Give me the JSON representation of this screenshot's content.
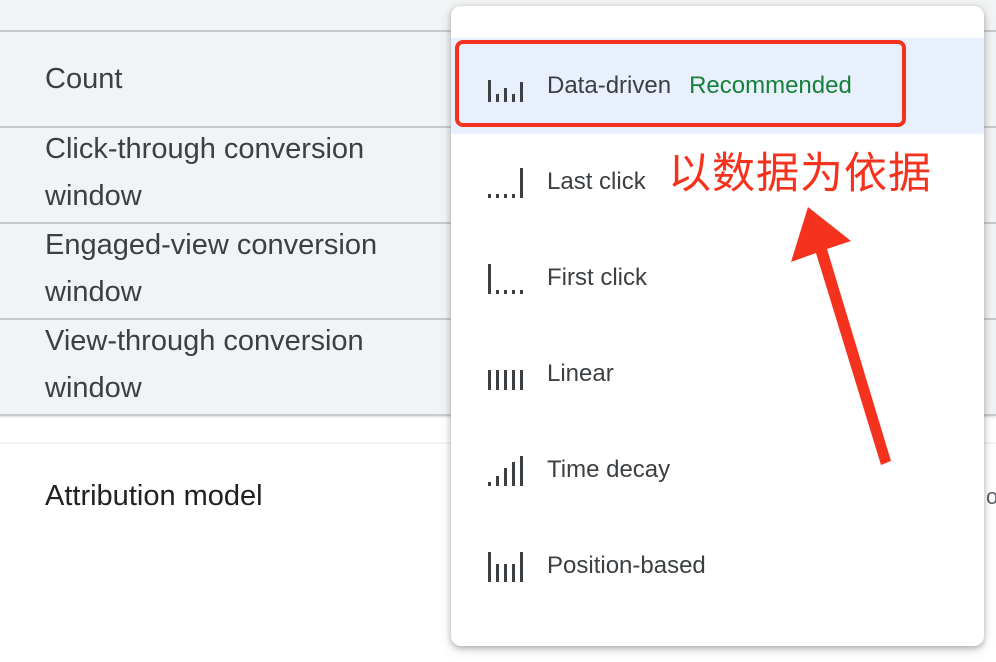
{
  "settings": {
    "rows": [
      {
        "label": "Count"
      },
      {
        "label": "Click-through conversion window"
      },
      {
        "label": "Engaged-view conversion window"
      },
      {
        "label": "View-through conversion window"
      }
    ],
    "attribution": {
      "label": "Attribution model",
      "edge_text": "o"
    }
  },
  "menu": {
    "items": [
      {
        "icon": "data-driven-icon",
        "label": "Data-driven",
        "badge": "Recommended",
        "selected": true
      },
      {
        "icon": "last-click-icon",
        "label": "Last click"
      },
      {
        "icon": "first-click-icon",
        "label": "First click"
      },
      {
        "icon": "linear-icon",
        "label": "Linear"
      },
      {
        "icon": "time-decay-icon",
        "label": "Time decay"
      },
      {
        "icon": "position-based-icon",
        "label": "Position-based"
      }
    ]
  },
  "annotation": {
    "text": "以数据为依据",
    "color": "#f4321e"
  },
  "colors": {
    "selected_bg": "#e8f0fe",
    "recommended": "#188038",
    "panel_bg": "#f1f3f4"
  }
}
